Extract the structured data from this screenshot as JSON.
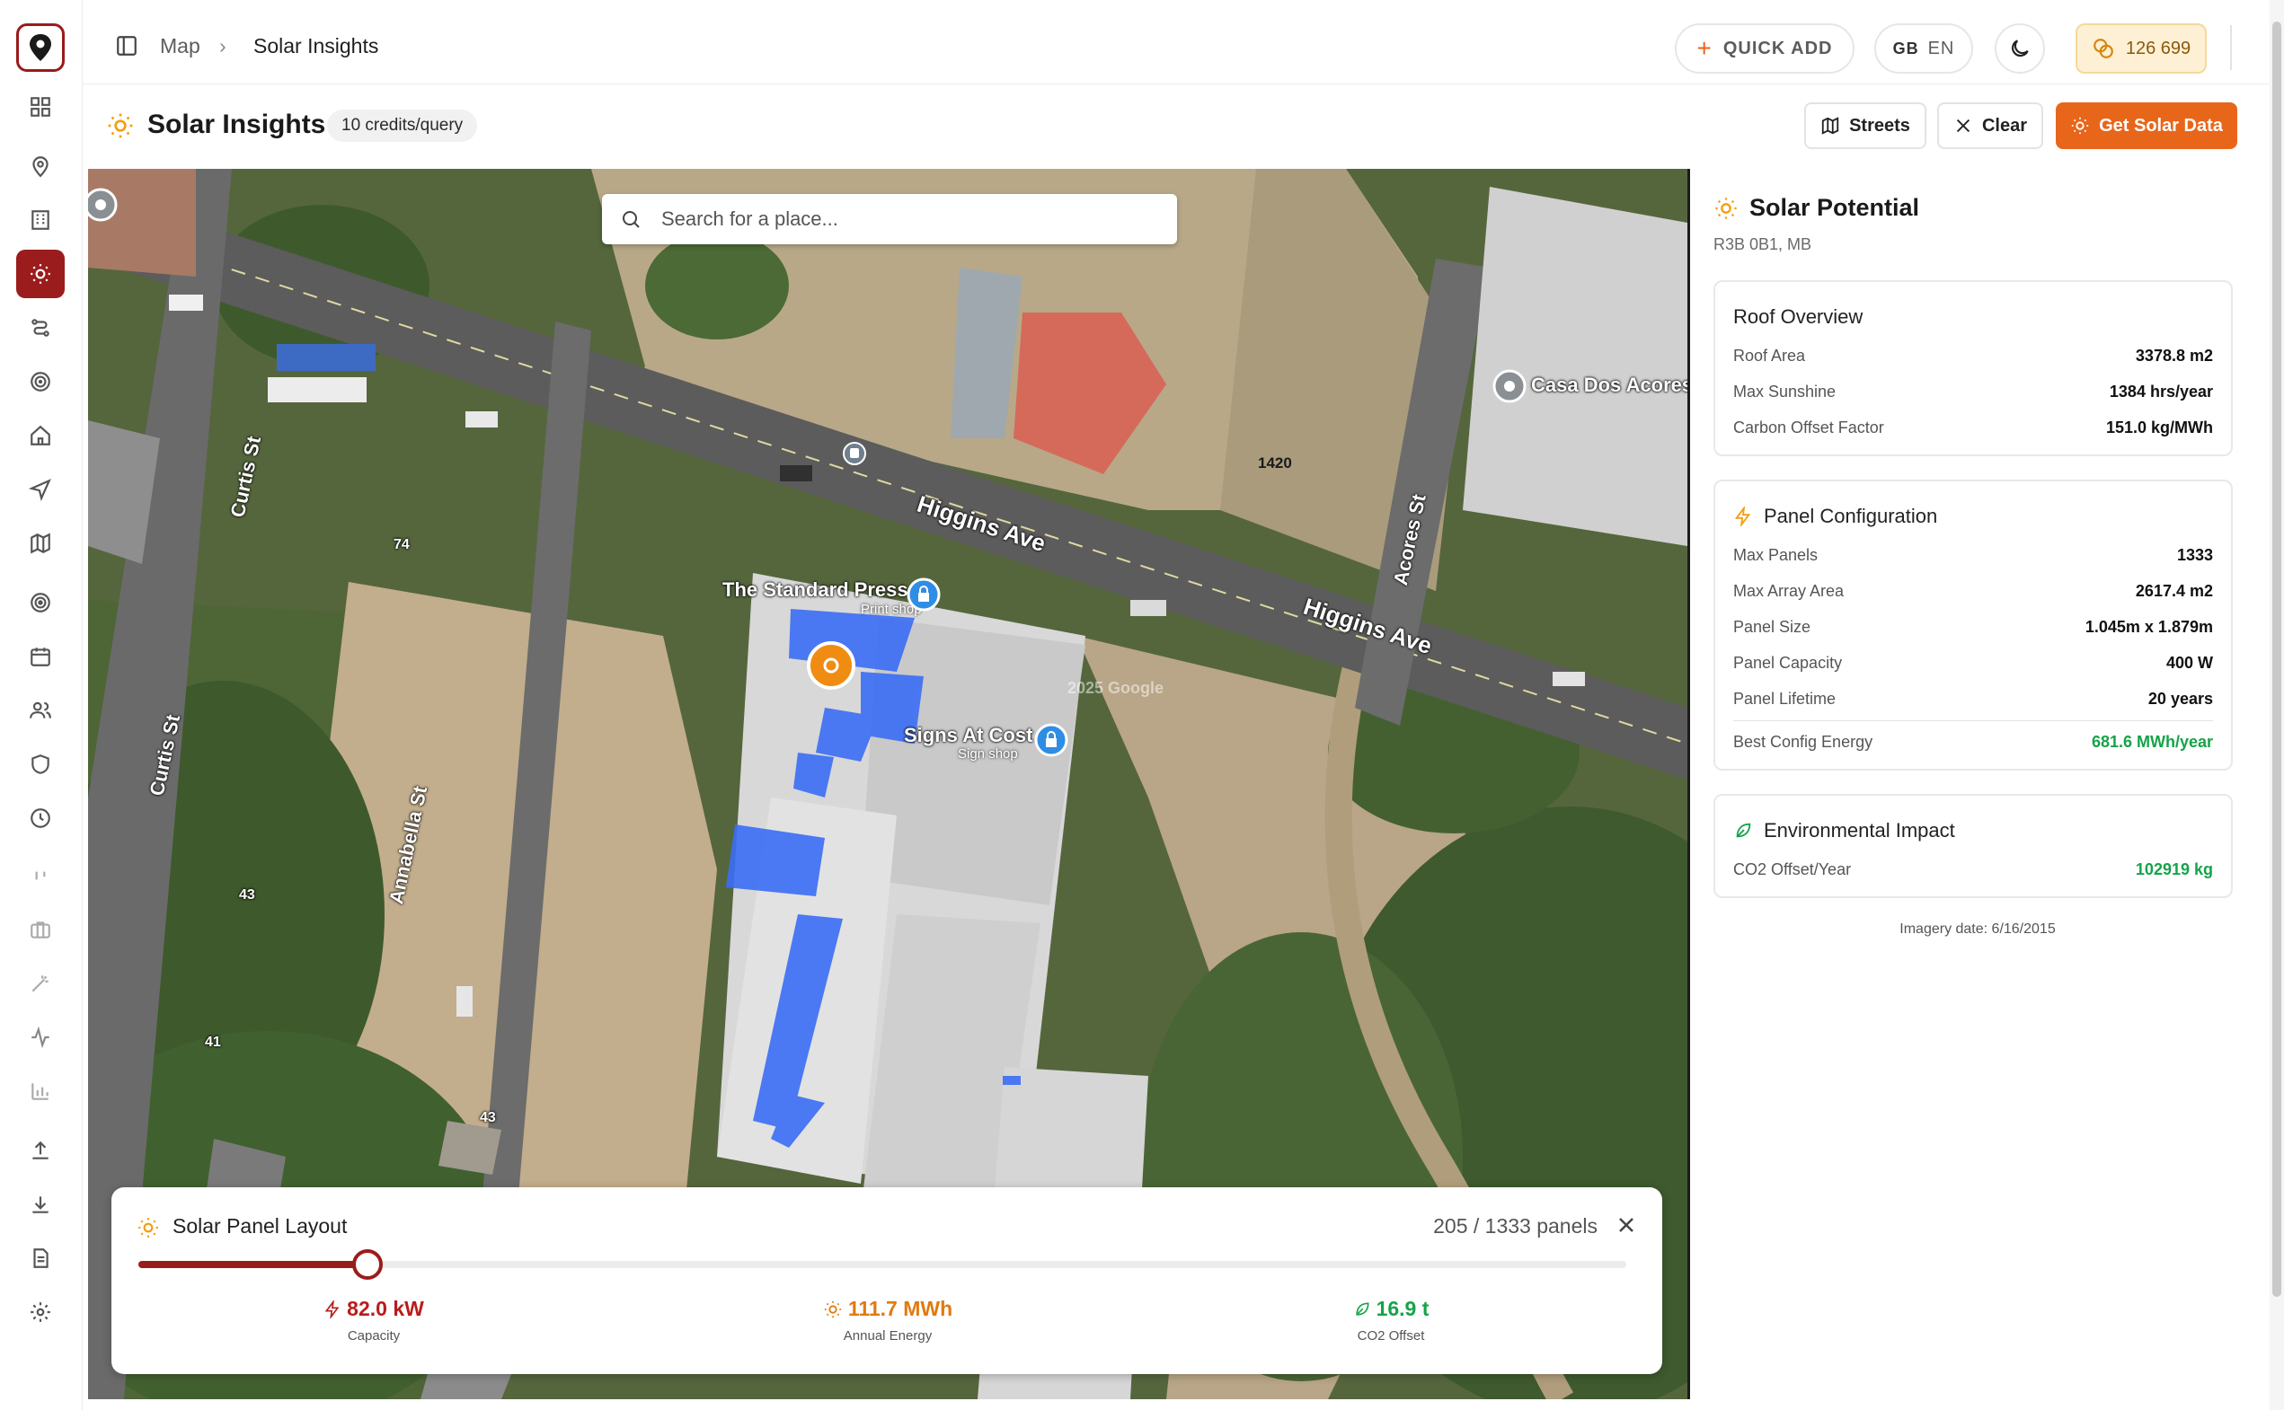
{
  "breadcrumb": {
    "root": "Map",
    "separator": "›",
    "current": "Solar Insights"
  },
  "topbar": {
    "quick_add": "QUICK ADD",
    "lang_flag": "GB",
    "lang_code": "EN",
    "credits": "126 699"
  },
  "page": {
    "title": "Solar Insights",
    "credits_badge": "10 credits/query",
    "btn_streets": "Streets",
    "btn_clear": "Clear",
    "btn_solar": "Get Solar Data"
  },
  "map": {
    "search_placeholder": "Search for a place...",
    "labels": {
      "higgins_1": "Higgins Ave",
      "higgins_2": "Higgins Ave",
      "curtis_1": "Curtis St",
      "curtis_2": "Curtis St",
      "annabella": "Annabella St",
      "acores": "Acores St",
      "num_1420": "1420",
      "num_74": "74",
      "num_43a": "43",
      "num_41": "41",
      "num_43b": "43",
      "standard_press": "The Standard Press",
      "standard_press_sub": "Print shop",
      "signs_at_cost": "Signs At Cost",
      "signs_at_cost_sub": "Sign shop",
      "casa": "Casa Dos Acores",
      "watermark": "2025 Google"
    }
  },
  "layout_card": {
    "title": "Solar Panel Layout",
    "panels_selected": 205,
    "panels_max": 1333,
    "count_text": "205 / 1333 panels",
    "capacity_value": "82.0 kW",
    "capacity_label": "Capacity",
    "energy_value": "111.7 MWh",
    "energy_label": "Annual Energy",
    "co2_value": "16.9 t",
    "co2_label": "CO2 Offset"
  },
  "solar_potential": {
    "title": "Solar Potential",
    "location": "R3B 0B1, MB",
    "roof_overview": {
      "title": "Roof Overview",
      "rows": [
        {
          "label": "Roof Area",
          "value": "3378.8 m2"
        },
        {
          "label": "Max Sunshine",
          "value": "1384 hrs/year"
        },
        {
          "label": "Carbon Offset Factor",
          "value": "151.0 kg/MWh"
        }
      ]
    },
    "panel_config": {
      "title": "Panel Configuration",
      "rows": [
        {
          "label": "Max Panels",
          "value": "1333"
        },
        {
          "label": "Max Array Area",
          "value": "2617.4 m2"
        },
        {
          "label": "Panel Size",
          "value": "1.045m x 1.879m"
        },
        {
          "label": "Panel Capacity",
          "value": "400 W"
        },
        {
          "label": "Panel Lifetime",
          "value": "20 years"
        }
      ],
      "best_label": "Best Config Energy",
      "best_value": "681.6 MWh/year"
    },
    "environmental": {
      "title": "Environmental Impact",
      "co2_label": "CO2 Offset/Year",
      "co2_value": "102919 kg"
    },
    "imagery_date": "Imagery date: 6/16/2015"
  },
  "colors": {
    "brand": "#9b1c1c",
    "accent_orange": "#e8661a",
    "green": "#16a34a",
    "panel_blue": "#3b6ef5"
  }
}
